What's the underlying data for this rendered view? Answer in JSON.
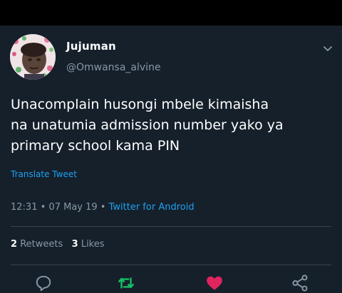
{
  "tweet": {
    "display_name": "Jujuman",
    "handle": "@Omwansa_alvine",
    "text_lines": [
      "Unacomplain husongi mbele kimaisha",
      "na unatumia admission number yako ya",
      "primary school kama PIN"
    ],
    "translate_label": "Translate Tweet",
    "time": "12:31",
    "date": "07 May 19",
    "separator": "•",
    "client": "Twitter for Android",
    "retweet_count": "2",
    "retweet_label": "Retweets",
    "like_count": "3",
    "like_label": "Likes"
  },
  "actions": {
    "reply_icon": "speech-bubble-icon",
    "retweet_icon": "retweet-arrows-icon",
    "like_icon": "heart-icon",
    "share_icon": "share-nodes-icon"
  },
  "colors": {
    "background": "#15202b",
    "accent": "#1da1f2",
    "secondary_text": "#8899a6",
    "retweet_green": "#17bf63",
    "like_pink": "#e0245e"
  }
}
